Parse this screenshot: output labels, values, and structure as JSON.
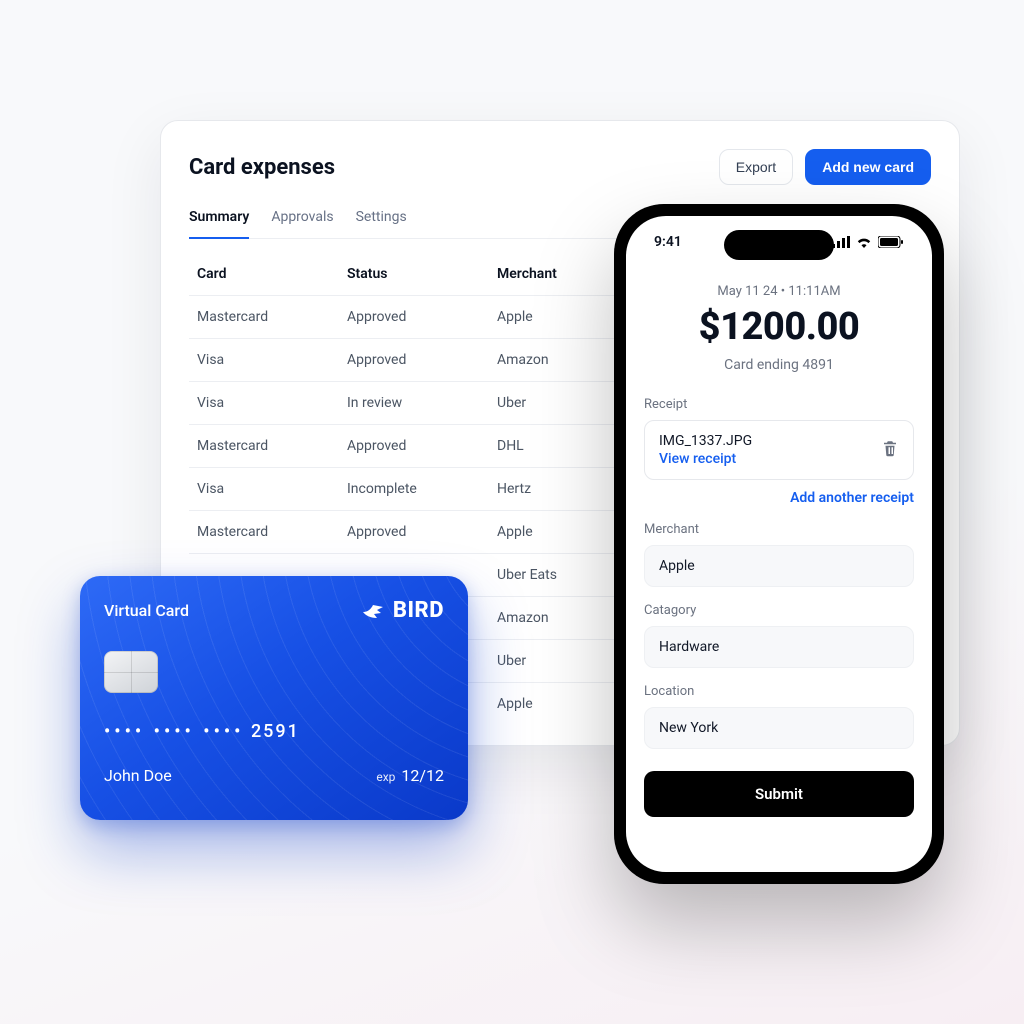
{
  "panel": {
    "title": "Card expenses",
    "export_label": "Export",
    "add_card_label": "Add new card",
    "tabs": [
      {
        "label": "Summary",
        "active": true
      },
      {
        "label": "Approvals",
        "active": false
      },
      {
        "label": "Settings",
        "active": false
      }
    ],
    "columns": {
      "card": "Card",
      "status": "Status",
      "merchant": "Merchant"
    },
    "rows": [
      {
        "card": "Mastercard",
        "status": "Approved",
        "merchant": "Apple"
      },
      {
        "card": "Visa",
        "status": "Approved",
        "merchant": "Amazon"
      },
      {
        "card": "Visa",
        "status": "In review",
        "merchant": "Uber"
      },
      {
        "card": "Mastercard",
        "status": "Approved",
        "merchant": "DHL"
      },
      {
        "card": "Visa",
        "status": "Incomplete",
        "merchant": "Hertz"
      },
      {
        "card": "Mastercard",
        "status": "Approved",
        "merchant": "Apple"
      },
      {
        "card": "",
        "status": "",
        "merchant": "Uber Eats"
      },
      {
        "card": "",
        "status": "",
        "merchant": "Amazon"
      },
      {
        "card": "",
        "status": "",
        "merchant": "Uber"
      },
      {
        "card": "",
        "status": "",
        "merchant": "Apple"
      }
    ]
  },
  "vcard": {
    "label": "Virtual Card",
    "brand": "BIRD",
    "last4": "2591",
    "holder": "John Doe",
    "exp_label": "exp",
    "exp": "12/12"
  },
  "phone": {
    "time": "9:41",
    "timestamp": "May 11 24 • 11:11AM",
    "amount": "$1200.00",
    "card_ending_label": "Card ending 4891",
    "receipt_label": "Receipt",
    "receipt_file": "IMG_1337.JPG",
    "view_receipt_label": "View receipt",
    "add_receipt_label": "Add another receipt",
    "merchant_label": "Merchant",
    "merchant_value": "Apple",
    "category_label": "Catagory",
    "category_value": "Hardware",
    "location_label": "Location",
    "location_value": "New York",
    "submit_label": "Submit"
  }
}
